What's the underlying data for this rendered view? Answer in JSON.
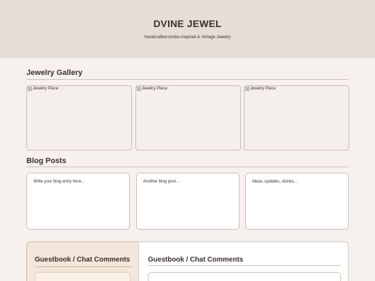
{
  "header": {
    "title": "DVINE JEWEL",
    "tagline": "Handcrafted Andes-Inspired & Vintage Jewelry"
  },
  "gallery": {
    "title": "Jewelry Gallery",
    "items": [
      {
        "alt": "Jewelry Piece"
      },
      {
        "alt": "Jewelry Piece"
      },
      {
        "alt": "Jewelry Piece"
      }
    ]
  },
  "blog": {
    "title": "Blog Posts",
    "entries": [
      {
        "placeholder": "Write your blog entry here..."
      },
      {
        "placeholder": "Another blog post..."
      },
      {
        "placeholder": "Ideas, updates, stories..."
      }
    ]
  },
  "guestbook": {
    "left_title": "Guestbook / Chat Comments",
    "right_title": "Guestbook / Chat Comments"
  },
  "colors": {
    "header_bg": "#e8ddd4",
    "page_bg": "#f6f1ee",
    "text": "#3a2f2a",
    "guestbook_accent": "#f3e6da"
  }
}
